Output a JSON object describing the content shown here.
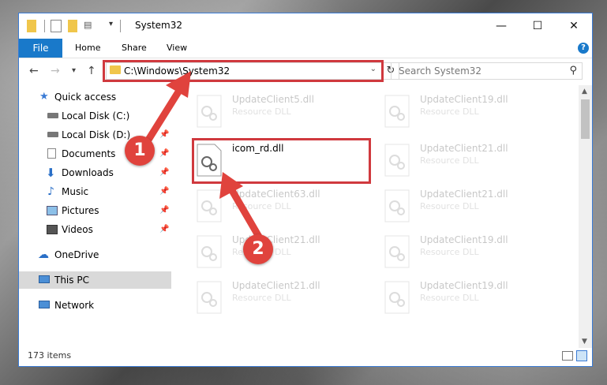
{
  "window": {
    "title": "System32",
    "controls": {
      "minimize": "—",
      "maximize": "☐",
      "close": "✕"
    }
  },
  "ribbon": {
    "file_tab": "File",
    "tabs": [
      "Home",
      "Share",
      "View"
    ],
    "help": "?"
  },
  "address_bar": {
    "path": "C:\\Windows\\System32",
    "refresh": "↻"
  },
  "search": {
    "placeholder": "Search System32"
  },
  "sidebar": {
    "items": [
      {
        "label": "Quick access"
      },
      {
        "label": "Local Disk (C:)"
      },
      {
        "label": "Local Disk (D:)"
      },
      {
        "label": "Documents"
      },
      {
        "label": "Downloads"
      },
      {
        "label": "Music"
      },
      {
        "label": "Pictures"
      },
      {
        "label": "Videos"
      },
      {
        "label": "OneDrive"
      },
      {
        "label": "This PC"
      },
      {
        "label": "Network"
      }
    ]
  },
  "files": {
    "highlighted": {
      "name": "icom_rd.dll"
    },
    "faded": [
      {
        "name": "UpdateClient5.dll",
        "desc": "Resource DLL"
      },
      {
        "name": "UpdateClient19.dll",
        "desc": "Resource DLL"
      },
      {
        "name": "UpdateClient21.dll",
        "desc": "Resource DLL"
      },
      {
        "name": "UpdateClient63.dll",
        "desc": "Resource DLL"
      },
      {
        "name": "UpdateClient21.dll",
        "desc": "Resource DLL"
      },
      {
        "name": "UpdateClient21.dll",
        "desc": "Resource DLL"
      },
      {
        "name": "UpdateClient19.dll",
        "desc": "Resource DLL"
      },
      {
        "name": "UpdateClient21.dll",
        "desc": "Resource DLL"
      },
      {
        "name": "UpdateClient19.dll",
        "desc": "Resource DLL"
      }
    ]
  },
  "status": {
    "item_count": "173 items"
  },
  "annotations": {
    "step1": "1",
    "step2": "2",
    "color": "#e0433d"
  }
}
